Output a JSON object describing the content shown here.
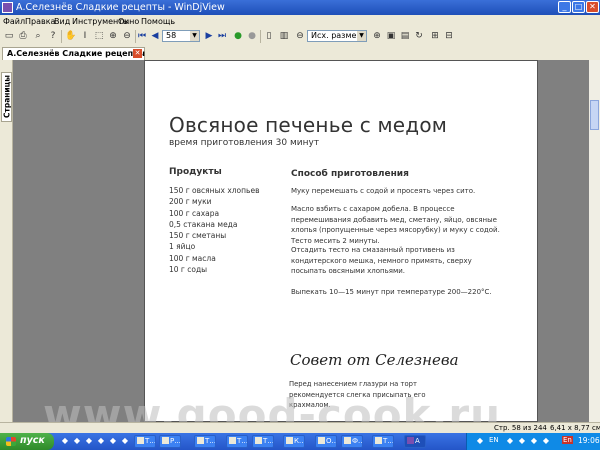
{
  "window": {
    "title": "А.Селезнёв Сладкие рецепты - WinDjView",
    "min_label": "_",
    "max_label": "□",
    "close_label": "✕"
  },
  "menu": [
    "Файл",
    "Правка",
    "Вид",
    "Инструменты",
    "Окно",
    "Помощь"
  ],
  "toolbar": {
    "page_number": "58",
    "zoom": "Исх. размер"
  },
  "document_tab": {
    "label": "А.Селезнёв Сладкие рецепты",
    "close_label": "✕"
  },
  "side_panel": {
    "tab_label": "Страницы"
  },
  "recipe": {
    "title": "Овсяное печенье с медом",
    "time": "время приготовления 30 минут",
    "products_heading": "Продукты",
    "ingredients": [
      "150 г овсяных хлопьев",
      "200 г муки",
      "100 г сахара",
      "0,5 стакана меда",
      "150 г сметаны",
      "1 яйцо",
      "100 г масла",
      "10 г соды"
    ],
    "method_heading": "Способ приготовления",
    "steps": [
      "Муку перемешать с содой и просеять через сито.",
      "Масло взбить с сахаром добела. В процессе перемешивания добавить мед, сметану, яйцо, овсяные хлопья (пропущенные через мясорубку) и муку с содой. Тесто месить 2 минуты.",
      "Отсадить тесто на смазанный противень из кондитерского мешка, немного примять, сверху посыпать овсяными хлопьями.",
      "Выпекать 10—15 минут при температуре 200—220°С."
    ],
    "advice_title": "Совет от Селезнева",
    "advice_text": "Перед нанесением глазури на торт рекомендуется слегка присыпать его крахмалом.",
    "watermark": "www.good-cook.ru"
  },
  "status": {
    "page": "Стр. 58 из 244",
    "size": "6,41 x 8,77 см"
  },
  "taskbar": {
    "start_label": "пуск",
    "tasks": [
      "Т...",
      "Р...",
      "Т...",
      "Т...",
      "Т...",
      "К...",
      "О...",
      "Ф...",
      "Т...",
      "А"
    ],
    "lang": "EN",
    "lang2": "En",
    "clock": "19:06"
  },
  "colors": {
    "titlebar": "#1e4fb8",
    "viewer_bg": "#808080",
    "taskbar": "#2455c8",
    "start": "#2e8a2a"
  }
}
